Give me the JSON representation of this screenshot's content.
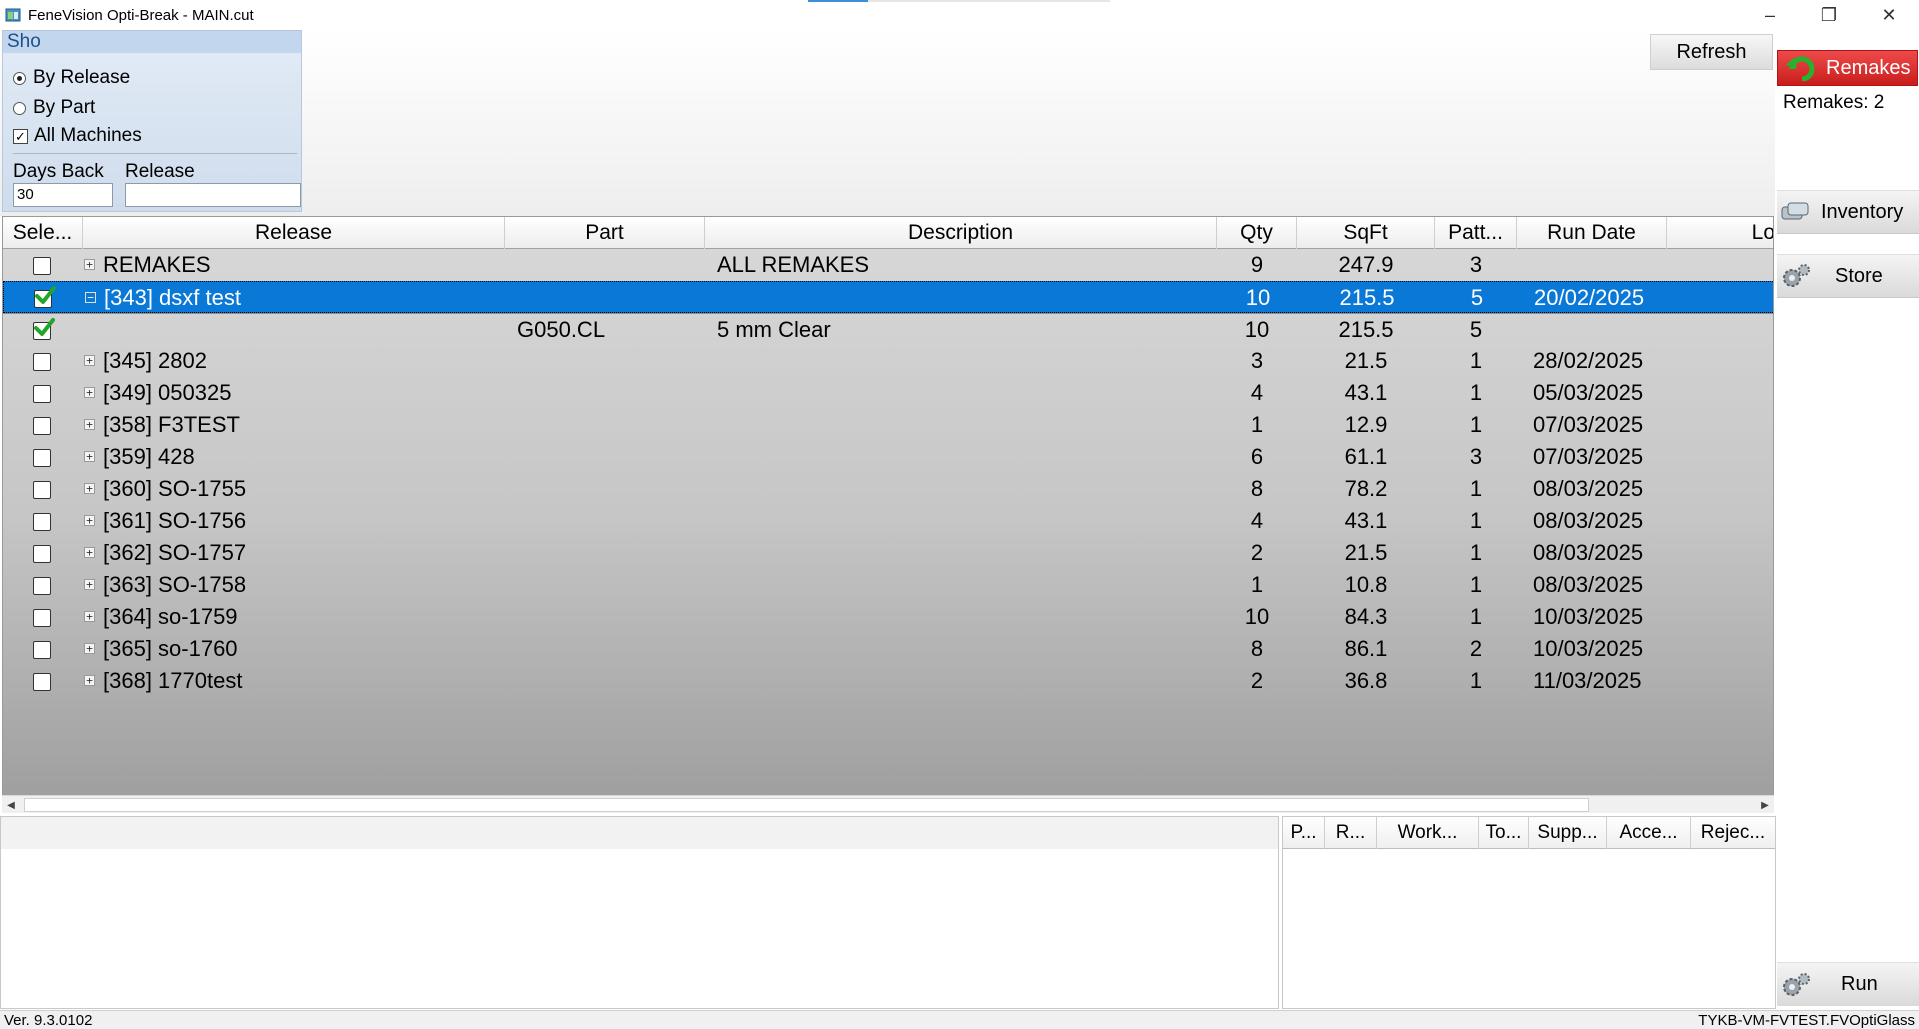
{
  "window": {
    "title": "FeneVision Opti-Break - MAIN.cut",
    "minimize": "–",
    "maximize": "❐",
    "close": "✕"
  },
  "show_panel": {
    "title": "Sho",
    "by_release_label": "By Release",
    "by_part_label": "By Part",
    "all_machines_label": "All Machines",
    "selected_mode": "By Release",
    "all_machines_checked": true,
    "days_back_label": "Days Back",
    "days_back_value": "30",
    "release_label": "Release",
    "release_value": ""
  },
  "toolbar": {
    "refresh_label": "Refresh"
  },
  "right_panel": {
    "remakes_label": "Remakes",
    "remakes_count": "Remakes: 2",
    "inventory_label": "Inventory",
    "store_label": "Store",
    "run_label": "Run"
  },
  "grid": {
    "columns": [
      "Sele...",
      "Release",
      "Part",
      "Description",
      "Qty",
      "SqFt",
      "Patt...",
      "Run Date",
      "Lo"
    ],
    "rows": [
      {
        "checked": false,
        "expander": "+",
        "release": "REMAKES",
        "part": "",
        "description": "ALL REMAKES",
        "qty": "9",
        "sqft": "247.9",
        "patt": "3",
        "run_date": "",
        "selected": false,
        "child": false
      },
      {
        "checked": true,
        "expander": "−",
        "release": "[343] dsxf test",
        "part": "",
        "description": "",
        "qty": "10",
        "sqft": "215.5",
        "patt": "5",
        "run_date": "20/02/2025",
        "selected": true,
        "child": false
      },
      {
        "checked": true,
        "expander": "",
        "release": "",
        "part": "G050.CL",
        "description": "5 mm Clear",
        "qty": "10",
        "sqft": "215.5",
        "patt": "5",
        "run_date": "",
        "selected": false,
        "child": true
      },
      {
        "checked": false,
        "expander": "+",
        "release": "[345] 2802",
        "part": "",
        "description": "",
        "qty": "3",
        "sqft": "21.5",
        "patt": "1",
        "run_date": "28/02/2025",
        "selected": false,
        "child": false
      },
      {
        "checked": false,
        "expander": "+",
        "release": "[349] 050325",
        "part": "",
        "description": "",
        "qty": "4",
        "sqft": "43.1",
        "patt": "1",
        "run_date": "05/03/2025",
        "selected": false,
        "child": false
      },
      {
        "checked": false,
        "expander": "+",
        "release": "[358] F3TEST",
        "part": "",
        "description": "",
        "qty": "1",
        "sqft": "12.9",
        "patt": "1",
        "run_date": "07/03/2025",
        "selected": false,
        "child": false
      },
      {
        "checked": false,
        "expander": "+",
        "release": "[359] 428",
        "part": "",
        "description": "",
        "qty": "6",
        "sqft": "61.1",
        "patt": "3",
        "run_date": "07/03/2025",
        "selected": false,
        "child": false
      },
      {
        "checked": false,
        "expander": "+",
        "release": "[360] SO-1755",
        "part": "",
        "description": "",
        "qty": "8",
        "sqft": "78.2",
        "patt": "1",
        "run_date": "08/03/2025",
        "selected": false,
        "child": false
      },
      {
        "checked": false,
        "expander": "+",
        "release": "[361] SO-1756",
        "part": "",
        "description": "",
        "qty": "4",
        "sqft": "43.1",
        "patt": "1",
        "run_date": "08/03/2025",
        "selected": false,
        "child": false
      },
      {
        "checked": false,
        "expander": "+",
        "release": "[362] SO-1757",
        "part": "",
        "description": "",
        "qty": "2",
        "sqft": "21.5",
        "patt": "1",
        "run_date": "08/03/2025",
        "selected": false,
        "child": false
      },
      {
        "checked": false,
        "expander": "+",
        "release": "[363] SO-1758",
        "part": "",
        "description": "",
        "qty": "1",
        "sqft": "10.8",
        "patt": "1",
        "run_date": "08/03/2025",
        "selected": false,
        "child": false
      },
      {
        "checked": false,
        "expander": "+",
        "release": "[364] so-1759",
        "part": "",
        "description": "",
        "qty": "10",
        "sqft": "84.3",
        "patt": "1",
        "run_date": "10/03/2025",
        "selected": false,
        "child": false
      },
      {
        "checked": false,
        "expander": "+",
        "release": "[365] so-1760",
        "part": "",
        "description": "",
        "qty": "8",
        "sqft": "86.1",
        "patt": "2",
        "run_date": "10/03/2025",
        "selected": false,
        "child": false
      },
      {
        "checked": false,
        "expander": "+",
        "release": "[368] 1770test",
        "part": "",
        "description": "",
        "qty": "2",
        "sqft": "36.8",
        "patt": "1",
        "run_date": "11/03/2025",
        "selected": false,
        "child": false
      }
    ]
  },
  "detail_grid": {
    "columns": [
      "P...",
      "R...",
      "Work...",
      "To...",
      "Supp...",
      "Acce...",
      "Rejec..."
    ]
  },
  "status": {
    "version": "Ver. 9.3.0102",
    "connection": "TYKB-VM-FVTEST.FVOptiGlass"
  },
  "colors": {
    "selection": "#0a78d7",
    "remakes_button": "#d92a2a",
    "check_green": "#22a52a",
    "panel_title": "#1f4e8c"
  },
  "icons": {
    "app": "app-window-icon",
    "remakes": "green-undo-arrow-icon",
    "inventory": "glass-sheets-icon",
    "store": "gears-icon",
    "run": "gears-icon"
  }
}
